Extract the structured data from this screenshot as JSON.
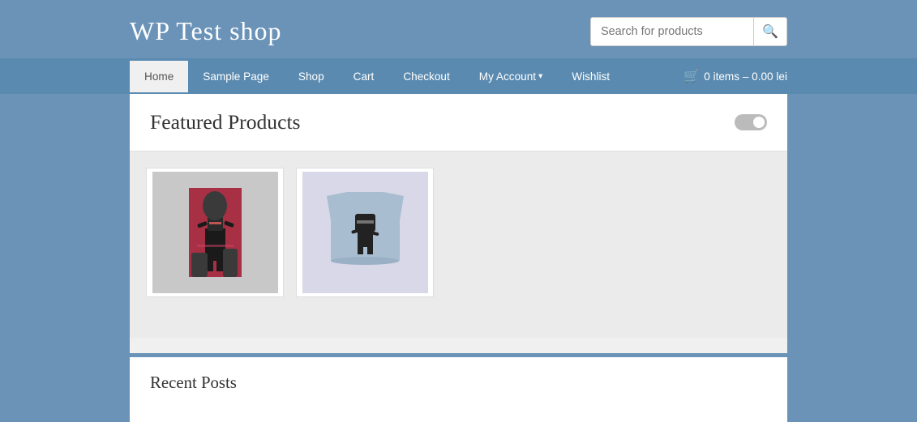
{
  "site": {
    "title": "WP Test shop"
  },
  "search": {
    "placeholder": "Search for products",
    "button_icon": "🔍"
  },
  "nav": {
    "items": [
      {
        "id": "home",
        "label": "Home",
        "active": true,
        "has_dropdown": false
      },
      {
        "id": "sample-page",
        "label": "Sample Page",
        "active": false,
        "has_dropdown": false
      },
      {
        "id": "shop",
        "label": "Shop",
        "active": false,
        "has_dropdown": false
      },
      {
        "id": "cart",
        "label": "Cart",
        "active": false,
        "has_dropdown": false
      },
      {
        "id": "checkout",
        "label": "Checkout",
        "active": false,
        "has_dropdown": false
      },
      {
        "id": "my-account",
        "label": "My Account",
        "active": false,
        "has_dropdown": true
      },
      {
        "id": "wishlist",
        "label": "Wishlist",
        "active": false,
        "has_dropdown": false
      }
    ],
    "cart": {
      "label": "0 items – 0.00 lei"
    }
  },
  "main": {
    "featured_title": "Featured Products",
    "products": [
      {
        "id": "product-1",
        "alt": "Ninja poster product"
      },
      {
        "id": "product-2",
        "alt": "T-shirt product"
      }
    ]
  },
  "sidebar": {
    "recent_posts_title": "Recent Posts"
  }
}
